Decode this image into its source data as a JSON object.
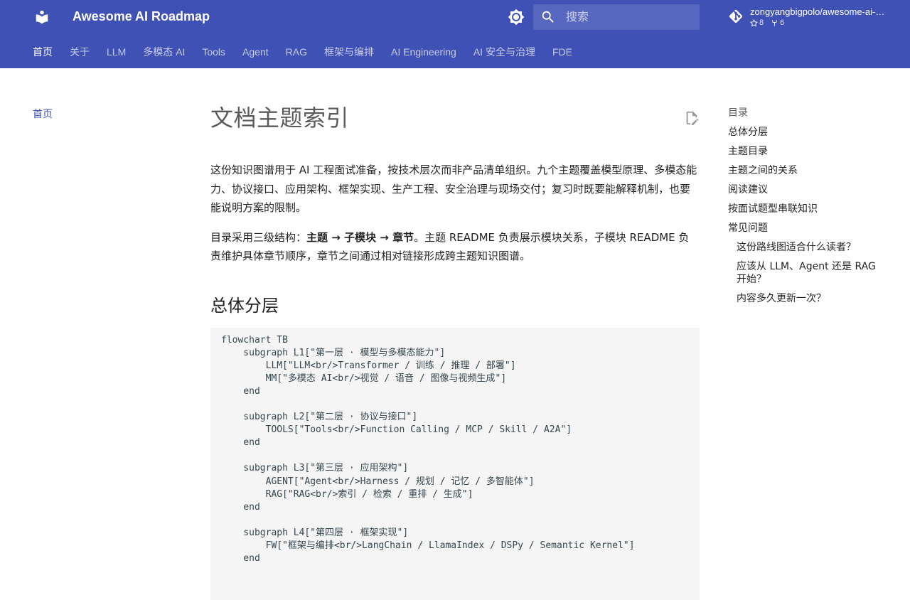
{
  "header": {
    "title": "Awesome AI Roadmap",
    "search_placeholder": "搜索",
    "repo": {
      "name": "zongyangbigpolo/awesome-ai-roadmap",
      "stars": "8",
      "forks": "6"
    },
    "accent_color": "#4051b5"
  },
  "tabs": [
    {
      "label": "首页",
      "active": true
    },
    {
      "label": "关于"
    },
    {
      "label": "LLM"
    },
    {
      "label": "多模态 AI"
    },
    {
      "label": "Tools"
    },
    {
      "label": "Agent"
    },
    {
      "label": "RAG"
    },
    {
      "label": "框架与编排"
    },
    {
      "label": "AI Engineering"
    },
    {
      "label": "AI 安全与治理"
    },
    {
      "label": "FDE"
    }
  ],
  "left_nav": {
    "home": "首页"
  },
  "content": {
    "title": "文档主题索引",
    "p1": "这份知识图谱用于 AI 工程面试准备，按技术层次而非产品清单组织。九个主题覆盖模型原理、多模态能力、协议接口、应用架构、框架实现、生产工程、安全治理与现场交付；复习时既要能解释机制，也要能说明方案的限制。",
    "p2_prefix": "目录采用三级结构：",
    "p2_b1": "主题",
    "p2_arrow1": " → ",
    "p2_b2": "子模块",
    "p2_arrow2": " → ",
    "p2_b3": "章节",
    "p2_suffix": "。主题 README 负责展示模块关系，子模块 README 负责维护具体章节顺序，章节之间通过相对链接形成跨主题知识图谱。",
    "section_title": "总体分层",
    "code": "flowchart TB\n    subgraph L1[\"第一层 · 模型与多模态能力\"]\n        LLM[\"LLM<br/>Transformer / 训练 / 推理 / 部署\"]\n        MM[\"多模态 AI<br/>视觉 / 语音 / 图像与视频生成\"]\n    end\n\n    subgraph L2[\"第二层 · 协议与接口\"]\n        TOOLS[\"Tools<br/>Function Calling / MCP / Skill / A2A\"]\n    end\n\n    subgraph L3[\"第三层 · 应用架构\"]\n        AGENT[\"Agent<br/>Harness / 规划 / 记忆 / 多智能体\"]\n        RAG[\"RAG<br/>索引 / 检索 / 重排 / 生成\"]\n    end\n\n    subgraph L4[\"第四层 · 框架实现\"]\n        FW[\"框架与编排<br/>LangChain / LlamaIndex / DSPy / Semantic Kernel\"]\n    end"
  },
  "toc": {
    "title": "目录",
    "items": [
      {
        "label": "总体分层"
      },
      {
        "label": "主题目录"
      },
      {
        "label": "主题之间的关系"
      },
      {
        "label": "阅读建议"
      },
      {
        "label": "按面试题型串联知识"
      },
      {
        "label": "常见问题"
      }
    ],
    "sub_items": [
      {
        "label": "这份路线图适合什么读者？"
      },
      {
        "label": "应该从 LLM、Agent 还是 RAG 开始？"
      },
      {
        "label": "内容多久更新一次？"
      }
    ]
  }
}
